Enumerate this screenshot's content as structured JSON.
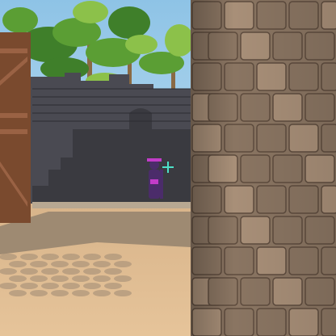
{
  "scene": {
    "colors": {
      "sky": "#8ec3e6",
      "sky_light": "#b9dcef",
      "palm_dark": "#3f7f2a",
      "palm_mid": "#5b9e34",
      "palm_light": "#8cc14a",
      "palm_trunk": "#8a6a44",
      "ruin_stone": "#4a4a52",
      "ruin_stone_dark": "#3a3a40",
      "ruin_mortar": "#2c2c32",
      "wood_door": "#7a4a2e",
      "wood_door_light": "#9a6244",
      "ground_shadow": "#9e8a72",
      "ground_sand": "#d8b48a",
      "ground_sand_light": "#e6c49a",
      "cobble": "#a48e76",
      "pillar_stone": "#8a7562",
      "pillar_stone_light": "#a88f78",
      "pillar_mortar": "#5e4c3e",
      "agent_body": "#4b2c6a",
      "agent_accent": "#c23cc9",
      "crosshair": "#4de0c8"
    },
    "icons": {
      "crosshair": "crosshair-icon"
    }
  }
}
